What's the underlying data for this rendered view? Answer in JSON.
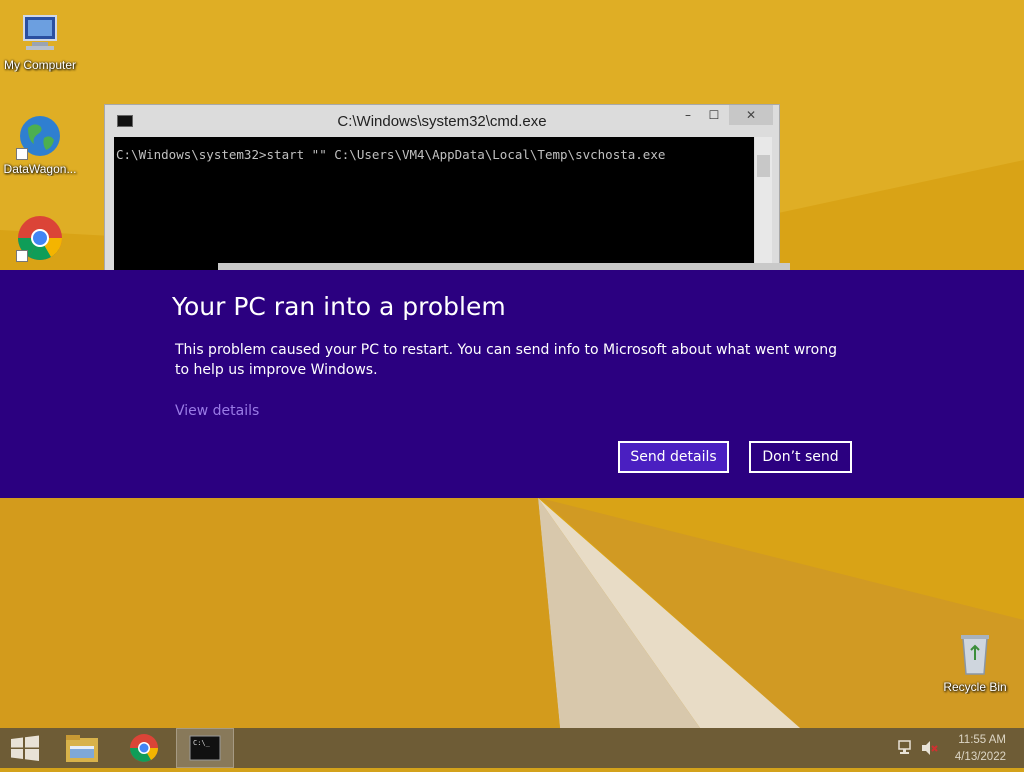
{
  "desktop": {
    "icons": [
      {
        "label": "My Computer",
        "icon": "computer-icon"
      },
      {
        "label": "DataWagon...",
        "icon": "globe-icon"
      },
      {
        "label": "",
        "icon": "chrome-icon"
      },
      {
        "label": "Recycle Bin",
        "icon": "recycle-bin-icon"
      }
    ]
  },
  "cmd_window": {
    "title": "C:\\Windows\\system32\\cmd.exe",
    "minimize": "–",
    "maximize": "☐",
    "close": "✕",
    "console_line": "C:\\Windows\\system32>start \"\" C:\\Users\\VM4\\AppData\\Local\\Temp\\svchosta.exe"
  },
  "error_dialog": {
    "title": "Your PC ran into a problem",
    "message": "This problem caused your PC to restart. You can send info to Microsoft about what went wrong to help us improve Windows.",
    "view_details": "View details",
    "send_details": "Send details",
    "dont_send": "Don’t send"
  },
  "taskbar": {
    "items": [
      "start-icon",
      "file-explorer-icon",
      "chrome-icon",
      "cmd-icon"
    ],
    "tray": {
      "time": "11:55 AM",
      "date": "4/13/2022",
      "icons": [
        "network-icon",
        "volume-muted-icon"
      ]
    }
  },
  "colors": {
    "banner": "#2b0080",
    "send_button": "#4a1fc1",
    "link": "#9a7be6",
    "taskbar": "#6e5c36"
  }
}
